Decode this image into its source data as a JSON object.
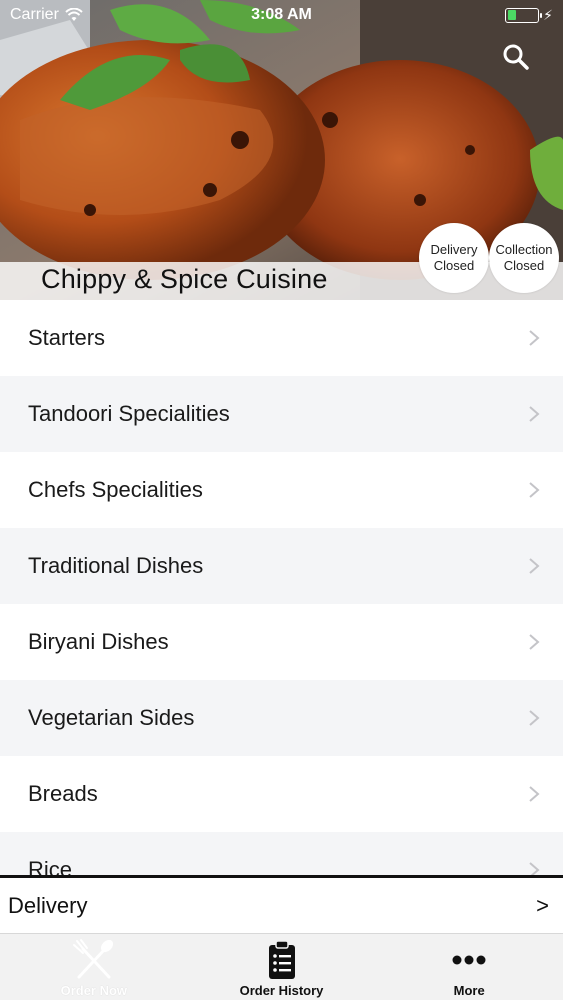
{
  "status_bar": {
    "carrier": "Carrier",
    "time": "3:08 AM"
  },
  "restaurant": {
    "name": "Chippy & Spice Cuisine"
  },
  "service_status": {
    "delivery": {
      "line1": "Delivery",
      "line2": "Closed"
    },
    "collection": {
      "line1": "Collection",
      "line2": "Closed"
    }
  },
  "menu": {
    "categories": [
      "Starters",
      "Tandoori Specialities",
      "Chefs Specialities",
      "Traditional Dishes",
      "Biryani Dishes",
      "Vegetarian Sides",
      "Breads",
      "Rice"
    ]
  },
  "order_mode": {
    "label": "Delivery",
    "arrow": ">"
  },
  "tabs": [
    {
      "label": "Order Now",
      "icon": "fork-knife-icon",
      "active": true
    },
    {
      "label": "Order History",
      "icon": "clipboard-list-icon",
      "active": false
    },
    {
      "label": "More",
      "icon": "more-dots-icon",
      "active": false
    }
  ],
  "colors": {
    "battery": "#4cd964",
    "alt_row": "#f4f5f7",
    "tab_bar": "#f2f2f2"
  }
}
